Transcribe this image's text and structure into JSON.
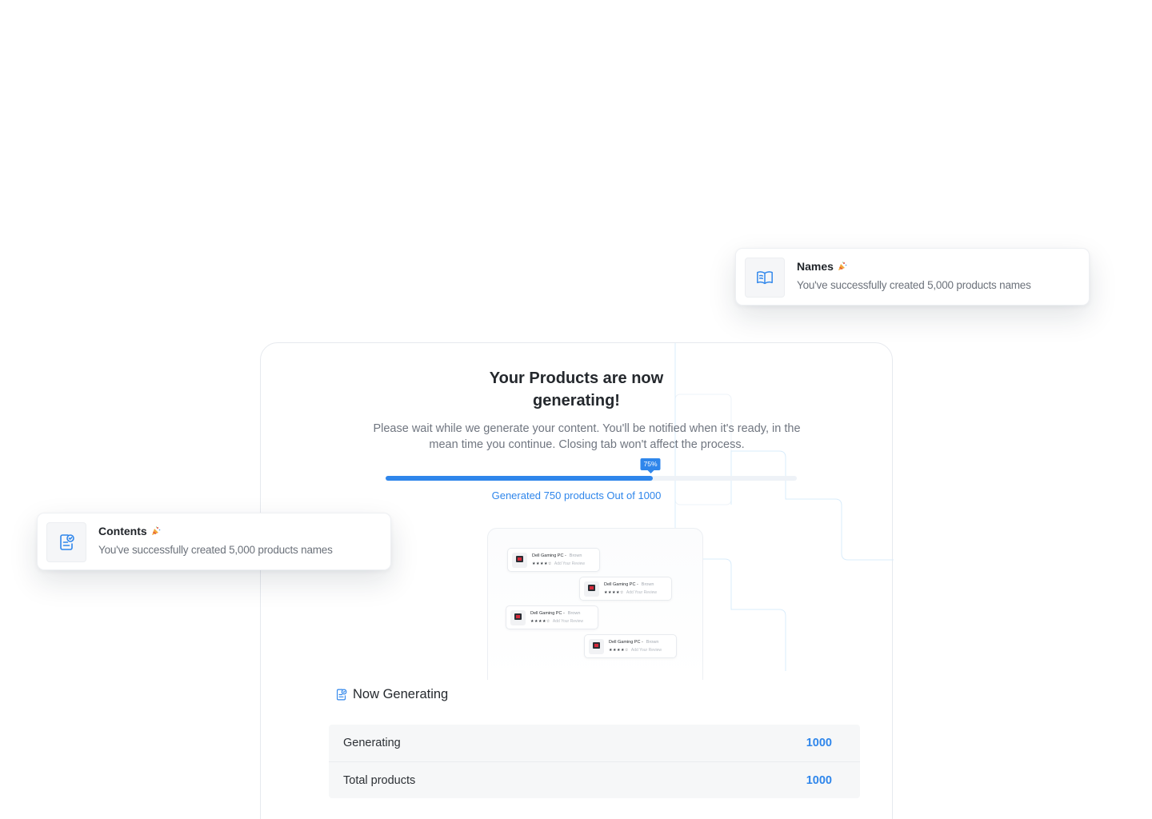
{
  "main": {
    "headline": "Your Products are now generating!",
    "description": "Please wait while we generate your content. You'll be notified when it's ready, in the mean time you continue. Closing tab won't affect the process.",
    "progress": {
      "percent": 75,
      "badge_label": "75%",
      "caption": "Generated 750 products Out of 1000",
      "fill_fraction": 0.65
    },
    "preview_items": [
      {
        "title": "Dell Gaming PC -",
        "variant": "Brown",
        "stars": "★★★★☆",
        "review_label": "Add Your Review"
      },
      {
        "title": "Dell Gaming PC -",
        "variant": "Brown",
        "stars": "★★★★☆",
        "review_label": "Add Your Review"
      },
      {
        "title": "Dell Gaming PC -",
        "variant": "Brown",
        "stars": "★★★★☆",
        "review_label": "Add Your Review"
      },
      {
        "title": "Dell Gaming PC -",
        "variant": "Brown",
        "stars": "★★★★☆",
        "review_label": "Add Your Review"
      }
    ],
    "now_generating": {
      "title": "Now Generating",
      "icon": "document-check-icon",
      "rows": [
        {
          "label": "Generating",
          "value": "1000"
        },
        {
          "label": "Total products",
          "value": "1000"
        }
      ]
    }
  },
  "toasts": {
    "names": {
      "title": "Names",
      "description": "You've successfully created 5,000 products names",
      "icon": "book-open-icon",
      "emoji": "party-popper-icon"
    },
    "contents": {
      "title": "Contents",
      "description": "You've successfully created 5,000 products names",
      "icon": "document-check-icon",
      "emoji": "party-popper-icon"
    }
  },
  "colors": {
    "accent": "#2f86eb",
    "text_primary": "#1f2328",
    "text_secondary": "#707680",
    "track": "#eef2f7",
    "table_bg": "#f6f7f8"
  }
}
